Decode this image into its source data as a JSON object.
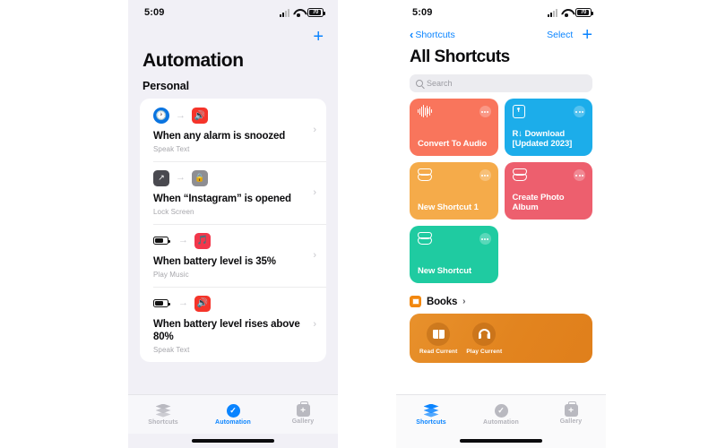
{
  "colors": {
    "accent_blue": "#0a84ff",
    "screen_bg": "#f1f0f6",
    "tile_coral": "#f9755c",
    "tile_blue": "#1cadea",
    "tile_orange": "#f5ab4a",
    "tile_pink": "#ed5f6e",
    "tile_green": "#1fcba1",
    "books_orange": "#e2841f",
    "red_icon": "#f5342a",
    "gray_icon": "#8e8e93"
  },
  "left_phone": {
    "status": {
      "time": "5:09",
      "battery_percent": "70",
      "wifi": "wifi-icon",
      "cellular": "cellular-icon"
    },
    "nav": {
      "add_label": "+"
    },
    "title": "Automation",
    "section_header": "Personal",
    "automations": [
      {
        "trigger_icon": "clock-icon",
        "trigger_color": "#0a74e0",
        "action_icon": "speaker-icon",
        "action_color": "#f5342a",
        "title": "When any alarm is snoozed",
        "subtitle": "Speak Text"
      },
      {
        "trigger_icon": "app-open-icon",
        "trigger_color": "#4a4a50",
        "action_icon": "lock-icon",
        "action_color": "#8e8e93",
        "title": "When “Instagram” is opened",
        "subtitle": "Lock Screen"
      },
      {
        "trigger_icon": "battery-icon",
        "trigger_color": "#111111",
        "action_icon": "music-icon",
        "action_color": "#f2374b",
        "title": "When battery level is 35%",
        "subtitle": "Play Music"
      },
      {
        "trigger_icon": "battery-icon",
        "trigger_color": "#111111",
        "action_icon": "speaker-icon",
        "action_color": "#f5342a",
        "title": "When battery level rises above 80%",
        "subtitle": "Speak Text"
      }
    ],
    "tabs": [
      {
        "label": "Shortcuts",
        "icon": "stack-icon",
        "active": false
      },
      {
        "label": "Automation",
        "icon": "automation-clock-icon",
        "active": true
      },
      {
        "label": "Gallery",
        "icon": "gallery-bag-icon",
        "active": false
      }
    ]
  },
  "right_phone": {
    "status": {
      "time": "5:09",
      "battery_percent": "70",
      "wifi": "wifi-icon",
      "cellular": "cellular-icon"
    },
    "nav": {
      "back_label": "Shortcuts",
      "select_label": "Select",
      "add_label": "+"
    },
    "title": "All Shortcuts",
    "search": {
      "placeholder": "Search",
      "value": ""
    },
    "shortcuts": [
      {
        "title": "Convert To Audio",
        "color": "#f9755c",
        "icon": "waveform-icon"
      },
      {
        "title": "R↓ Download [Updated 2023]",
        "color": "#1cadea",
        "icon": "download-icon"
      },
      {
        "title": "New Shortcut 1",
        "color": "#f5ab4a",
        "icon": "shortcut-glyph-icon"
      },
      {
        "title": "Create Photo Album",
        "color": "#ed5f6e",
        "icon": "shortcut-glyph-icon"
      },
      {
        "title": "New Shortcut",
        "color": "#1fcba1",
        "icon": "shortcut-glyph-icon"
      }
    ],
    "books_section": {
      "label": "Books",
      "chevron": "›",
      "actions": [
        {
          "label": "Read Current",
          "icon": "open-book-icon"
        },
        {
          "label": "Play Current",
          "icon": "headphones-icon"
        }
      ]
    },
    "tabs": [
      {
        "label": "Shortcuts",
        "icon": "stack-icon",
        "active": true
      },
      {
        "label": "Automation",
        "icon": "automation-clock-icon",
        "active": false
      },
      {
        "label": "Gallery",
        "icon": "gallery-bag-icon",
        "active": false
      }
    ]
  }
}
